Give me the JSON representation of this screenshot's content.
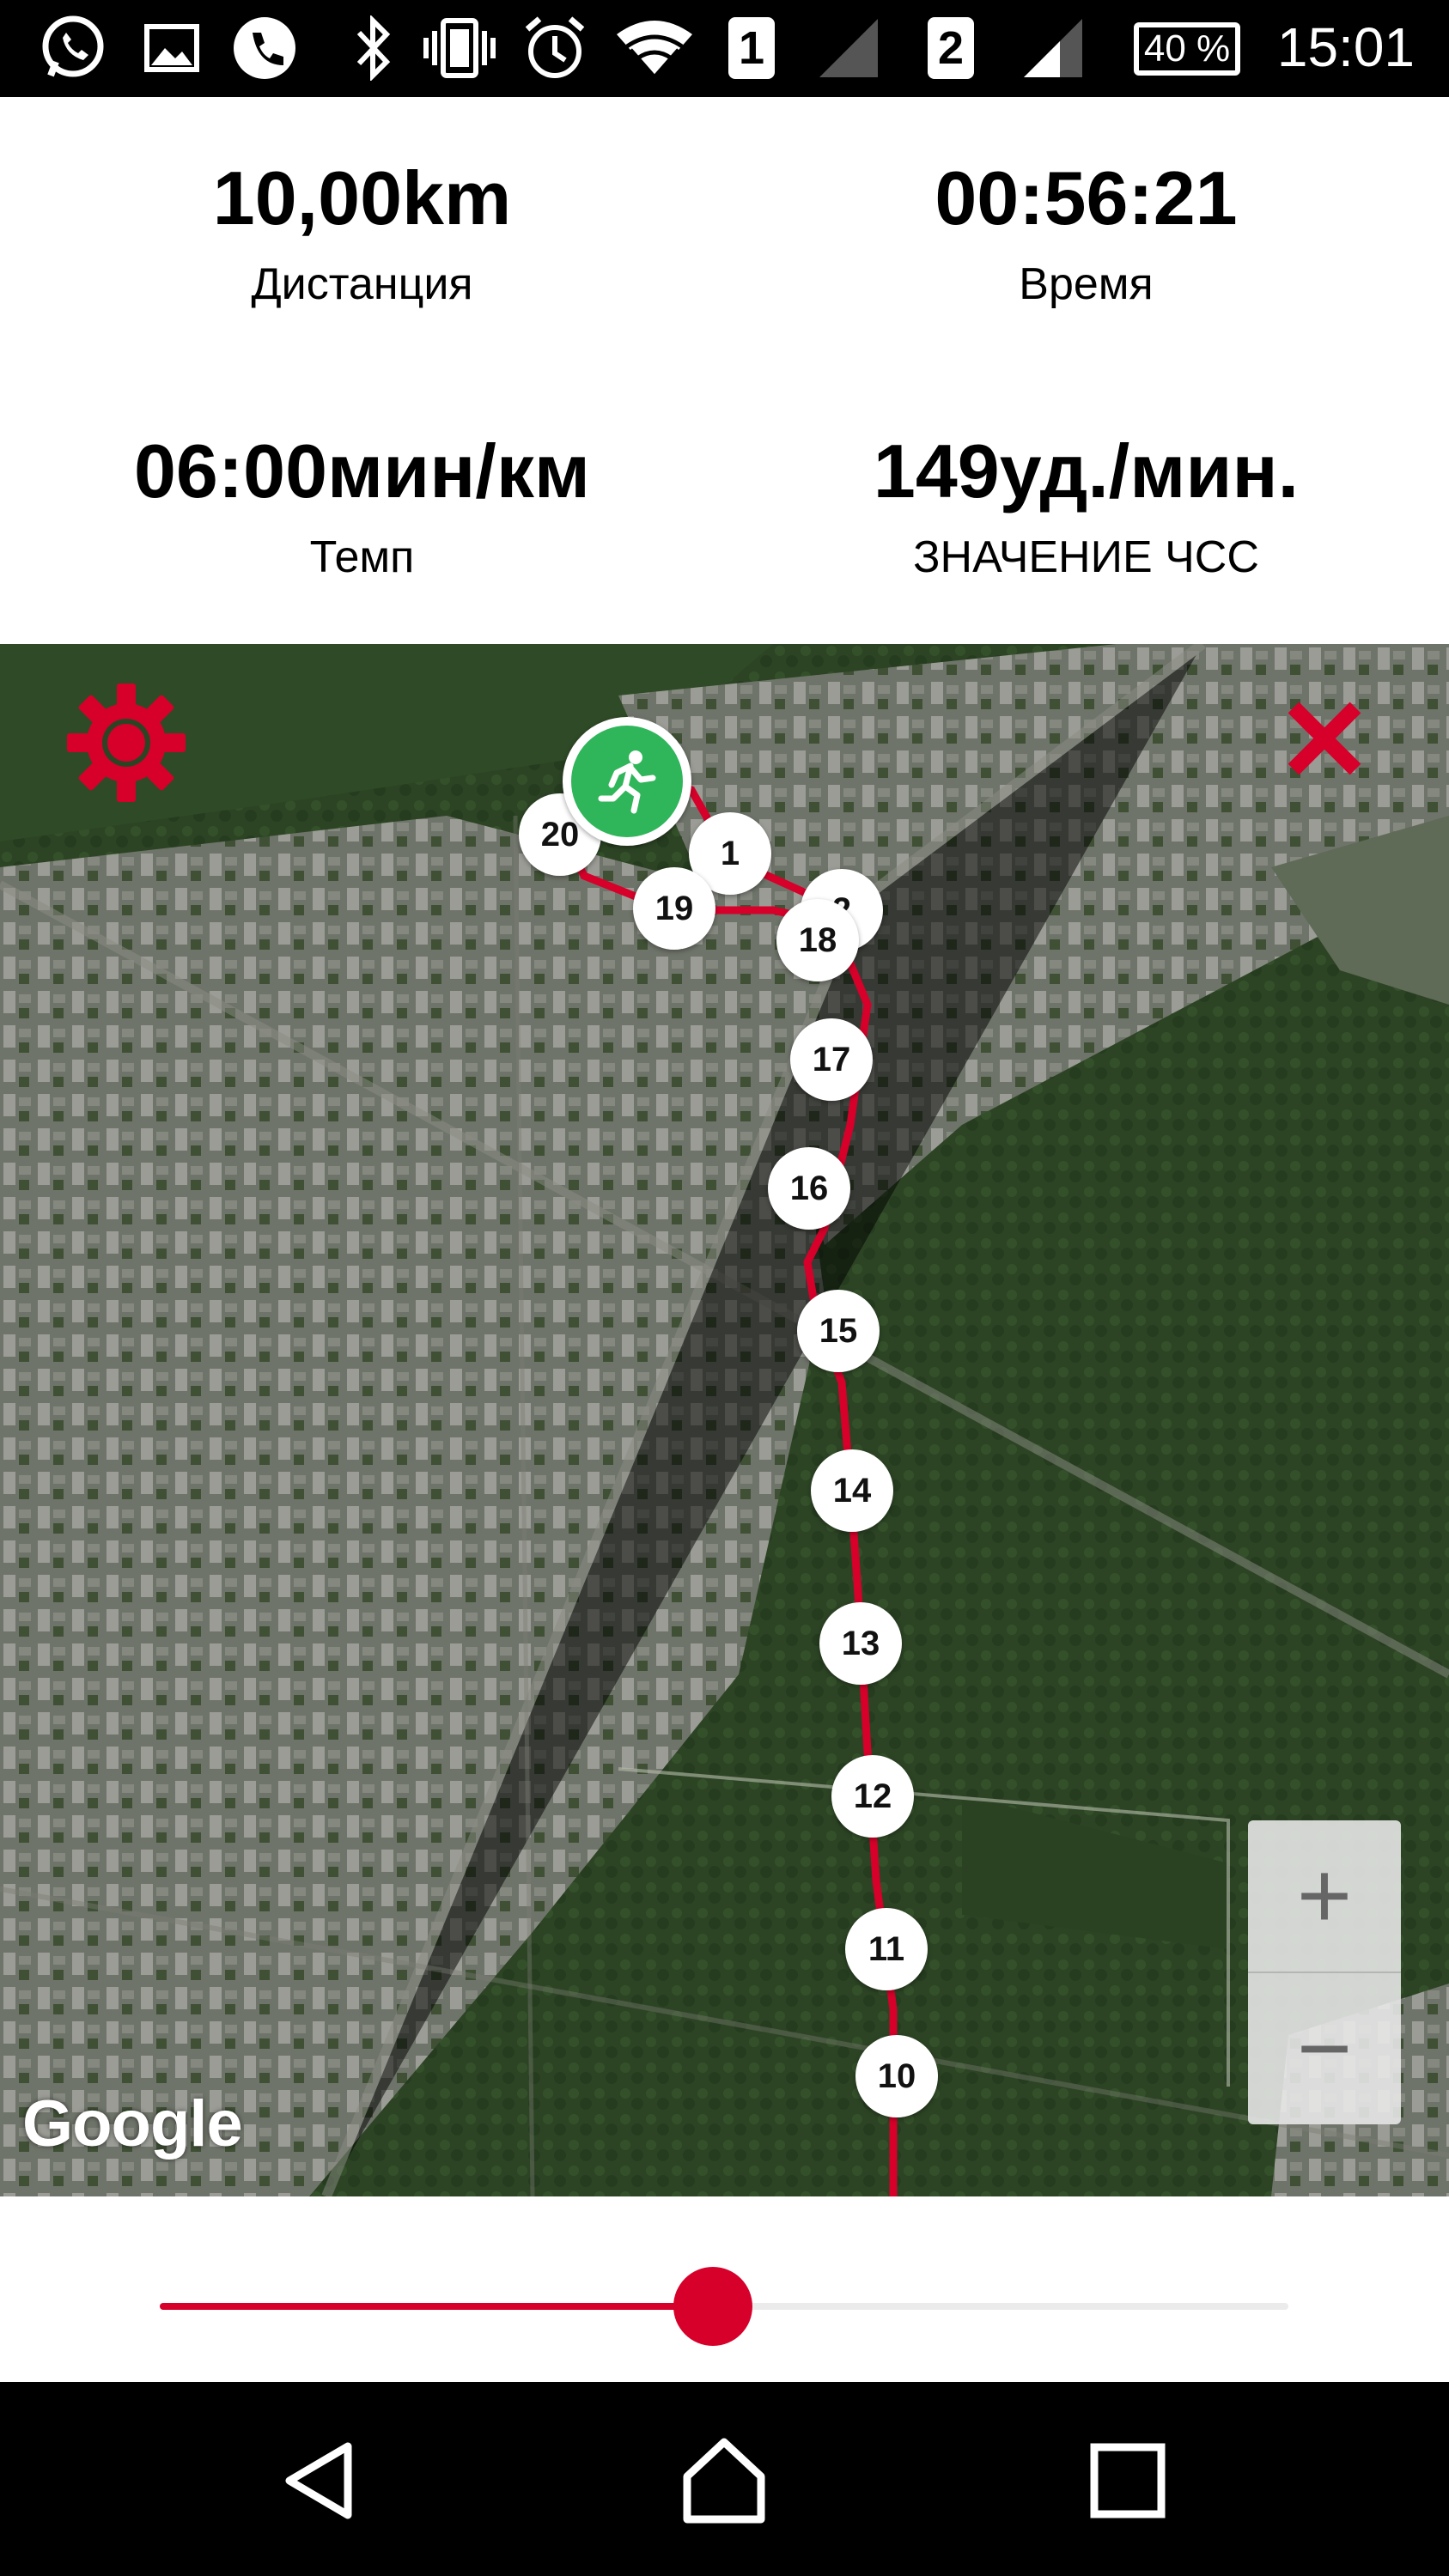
{
  "status_bar": {
    "icons": [
      "whatsapp-icon",
      "image-icon",
      "phone-icon",
      "bluetooth-icon",
      "vibrate-icon",
      "alarm-icon",
      "wifi-icon",
      "signal-icon"
    ],
    "sim1_label": "1",
    "sim2_label": "2",
    "battery": "40 %",
    "time": "15:01"
  },
  "stats": {
    "distance": {
      "value": "10,00km",
      "label": "Дистанция"
    },
    "time": {
      "value": "00:56:21",
      "label": "Время"
    },
    "pace": {
      "value": "06:00мин/км",
      "label": "Темп"
    },
    "heart_rate": {
      "value": "149уд./мин.",
      "label": "ЗНАЧЕНИЕ ЧСС"
    }
  },
  "map": {
    "attribution": "Google",
    "settings_icon": "gear-icon",
    "close_icon": "close-icon",
    "start_icon": "runner-icon",
    "zoom_in_label": "+",
    "zoom_out_label": "−",
    "km_markers": [
      "20",
      "1",
      "19",
      "2",
      "18",
      "17",
      "16",
      "15",
      "14",
      "13",
      "12",
      "11",
      "10"
    ],
    "route_color": "#d6002a",
    "start_color": "#2fb55a"
  },
  "slider": {
    "position": 0.49,
    "accent": "#d6002a"
  },
  "nav": {
    "icons": [
      "back-icon",
      "home-icon",
      "recents-icon"
    ]
  }
}
